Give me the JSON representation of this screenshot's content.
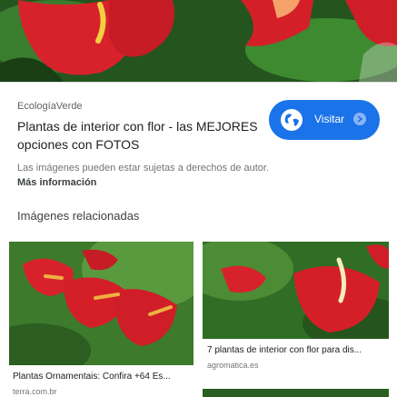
{
  "header": {
    "source_name": "EcologíaVerde",
    "title": "Plantas de interior con flor - las MEJORES opciones con FOTOS",
    "visit_label": "Visitar",
    "rights_notice": "Las imágenes pueden estar sujetas a derechos de autor.",
    "more_info_label": "Más información"
  },
  "related": {
    "heading": "Imágenes relacionadas",
    "items": [
      {
        "title": "Plantas Ornamentais: Confira +64 Es...",
        "source": "terra.com.br"
      },
      {
        "title": "7 plantas de interior con flor para dis...",
        "source": "agromatica.es"
      }
    ]
  },
  "colors": {
    "accent": "#1a73e8",
    "flower_red": "#d8222b",
    "leaf_green": "#2e6a25"
  },
  "icons": {
    "visit_icon": "globe-icon",
    "visit_arrow": "arrow-circle-icon"
  }
}
